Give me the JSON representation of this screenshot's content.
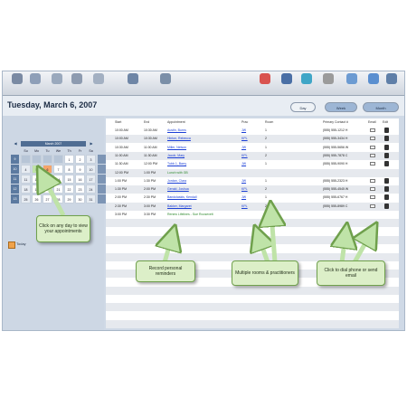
{
  "header": {
    "date_title": "Tuesday, March 6, 2007",
    "view_buttons": [
      "Day",
      "Week",
      "Month"
    ]
  },
  "calendar": {
    "month_label": "March 2007",
    "weekdays": [
      "Su",
      "Mo",
      "Tu",
      "We",
      "Th",
      "Fr",
      "Sa"
    ],
    "weeks": [
      {
        "wk": "9",
        "days": [
          "",
          "",
          "",
          "",
          "1",
          "2",
          "3"
        ]
      },
      {
        "wk": "10",
        "days": [
          "4",
          "5",
          "6",
          "7",
          "8",
          "9",
          "10"
        ]
      },
      {
        "wk": "11",
        "days": [
          "11",
          "12",
          "13",
          "14",
          "15",
          "16",
          "17"
        ]
      },
      {
        "wk": "12",
        "days": [
          "18",
          "19",
          "20",
          "21",
          "22",
          "23",
          "24"
        ]
      },
      {
        "wk": "13",
        "days": [
          "25",
          "26",
          "27",
          "28",
          "29",
          "30",
          "31"
        ]
      }
    ],
    "selected_day": "6",
    "highlight_colors": {
      "selected": "#f4a46a",
      "today": "#bfe3a8"
    },
    "today_label": "Today"
  },
  "table": {
    "columns": [
      "Start",
      "End",
      "Appointment",
      "Prac",
      "Room",
      "Primary Contact #",
      "Email",
      "Edit"
    ],
    "rows": [
      {
        "start": "10:00 AM",
        "end": "10:30 AM",
        "name": "Austin, Burns",
        "prac": "JW",
        "room": "1",
        "phone": "(555) 555-1212 H"
      },
      {
        "start": "10:00 AM",
        "end": "10:30 AM",
        "name": "Hinton, Rebecca",
        "prac": "KPL",
        "room": "2",
        "phone": "(555) 555-3434 H"
      },
      {
        "start": "10:30 AM",
        "end": "11:00 AM",
        "name": "Miller, Nelson",
        "prac": "JW",
        "room": "1",
        "phone": "(555) 555-5656 W"
      },
      {
        "start": "11:00 AM",
        "end": "11:30 AM",
        "name": "Jacob, Mary",
        "prac": "KPL",
        "room": "2",
        "phone": "(555) 555-7878 C"
      },
      {
        "start": "11:30 AM",
        "end": "12:00 PM",
        "name": "Tubb 1, Barry",
        "prac": "JW",
        "room": "1",
        "phone": "(555) 555-9090 H"
      },
      {
        "start": "12:00 PM",
        "end": "1:00 PM",
        "name": "Lunch with GB",
        "prac": "",
        "room": "",
        "phone": "",
        "note": true
      },
      {
        "start": "1:00 PM",
        "end": "1:30 PM",
        "name": "Jordan, Clara",
        "prac": "JW",
        "room": "1",
        "phone": "(555) 555-2323 H"
      },
      {
        "start": "1:30 PM",
        "end": "2:00 PM",
        "name": "Gerald, Joshua",
        "prac": "KPL",
        "room": "2",
        "phone": "(555) 555-4545 W"
      },
      {
        "start": "2:00 PM",
        "end": "2:30 PM",
        "name": "Bandolaskis, Kendall",
        "prac": "JW",
        "room": "1",
        "phone": "(555) 555-6767 H"
      },
      {
        "start": "2:30 PM",
        "end": "3:00 PM",
        "name": "Bakker, Margaret",
        "prac": "KPL",
        "room": "2",
        "phone": "(555) 555-8989 C"
      },
      {
        "start": "3:00 PM",
        "end": "3:30 PM",
        "name": "Renew Lifelines - Sue Roosevelt",
        "prac": "",
        "room": "",
        "phone": "",
        "note": true
      }
    ]
  },
  "callouts": {
    "click_day": "Click on any day to view your appointments",
    "reminders": "Record personal reminders",
    "multiple_rooms": "Multiple rooms & practitioners",
    "dial_phone": "Click to dial phone or send email"
  },
  "toolbar": {
    "icons": [
      "home-icon",
      "calendar-icon",
      "people-icon",
      "notes-icon",
      "print-icon",
      "nav-icon",
      "settings-icon",
      "chart-icon",
      "schedule-icon",
      "globe-icon",
      "search-icon",
      "tools-icon",
      "help-icon",
      "exit-icon"
    ],
    "colors": [
      "#7a8aa3",
      "#8e9fb8",
      "#9aa9bd",
      "#8d9bb0",
      "#a3b0c2",
      "#6f86a6",
      "#7b8fa8",
      "#d9534f",
      "#4a6fa5",
      "#3fa6c7",
      "#9b9b9b",
      "#6c9bd2",
      "#5a8fd0",
      "#5f7fa8"
    ]
  }
}
